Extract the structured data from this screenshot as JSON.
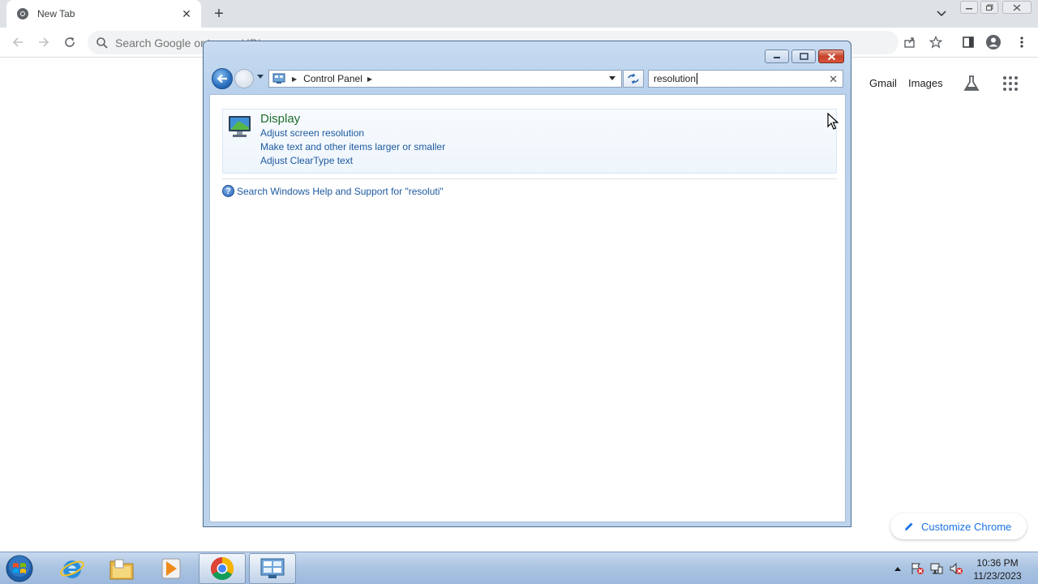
{
  "chrome": {
    "tab_title": "New Tab",
    "omnibox_placeholder": "Search Google or type a URL",
    "links": {
      "gmail": "Gmail",
      "images": "Images"
    },
    "customize_label": "Customize Chrome",
    "accent_color": "#1a73e8"
  },
  "control_panel": {
    "breadcrumb": [
      "Control Panel"
    ],
    "search_value": "resolution",
    "result": {
      "title": "Display",
      "links": [
        "Adjust screen resolution",
        "Make text and other items larger or smaller",
        "Adjust ClearType text"
      ]
    },
    "help_text": "Search Windows Help and Support for \"resoluti\"",
    "icons": [
      "back-icon",
      "forward-icon",
      "refresh-icon",
      "display-icon",
      "help-icon"
    ]
  },
  "taskbar": {
    "apps": [
      "start-orb",
      "internet-explorer-icon",
      "file-explorer-icon",
      "media-player-icon",
      "chrome-icon",
      "control-panel-icon"
    ],
    "clock": {
      "time": "10:36 PM",
      "date": "11/23/2023"
    }
  }
}
